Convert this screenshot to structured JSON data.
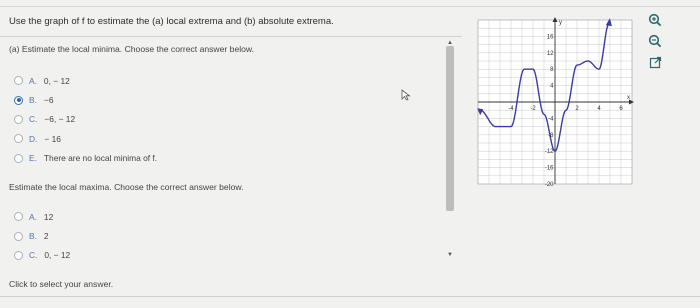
{
  "question": "Use the graph of f to estimate the (a) local extrema and (b) absolute extrema.",
  "part_a": {
    "prompt": "(a) Estimate the local minima. Choose the correct answer below.",
    "choices": [
      {
        "letter": "A.",
        "text": "0, − 12",
        "selected": false
      },
      {
        "letter": "B.",
        "text": "−6",
        "selected": true
      },
      {
        "letter": "C.",
        "text": "−6, − 12",
        "selected": false
      },
      {
        "letter": "D.",
        "text": "− 16",
        "selected": false
      },
      {
        "letter": "E.",
        "text": "There are no local minima of f.",
        "selected": false
      }
    ]
  },
  "part_b": {
    "prompt": "Estimate the local maxima. Choose the correct answer below.",
    "choices": [
      {
        "letter": "A.",
        "text": "12",
        "selected": false
      },
      {
        "letter": "B.",
        "text": "2",
        "selected": false
      },
      {
        "letter": "C.",
        "text": "0, − 12",
        "selected": false
      }
    ]
  },
  "hint": "Click to select your answer.",
  "graph": {
    "x_axis_label": "x",
    "y_axis_label": "y",
    "x_ticks": [
      "-4",
      "-2",
      "2",
      "4",
      "6"
    ],
    "y_ticks": [
      "16",
      "12",
      "8",
      "4",
      "-4",
      "-8",
      "-12",
      "-16",
      "-20"
    ],
    "curve_color": "#3a3aaa"
  },
  "icons": [
    "zoom-in-icon",
    "zoom-out-icon",
    "popout-icon"
  ]
}
